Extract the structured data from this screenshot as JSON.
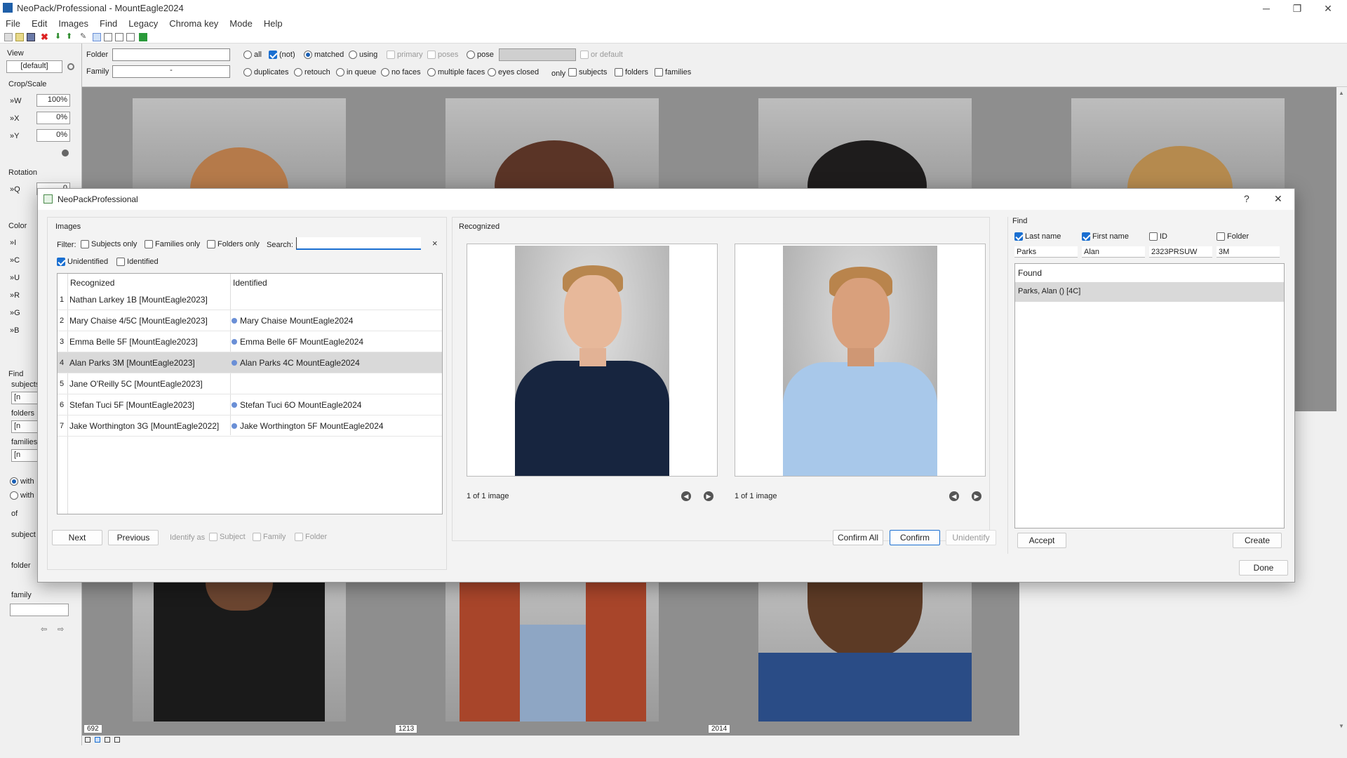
{
  "window": {
    "title": "NeoPack/Professional - MountEagle2024",
    "minimize": "─",
    "maximize": "❐",
    "close": "✕"
  },
  "menu": [
    "File",
    "Edit",
    "Images",
    "Find",
    "Legacy",
    "Chroma key",
    "Mode",
    "Help"
  ],
  "left": {
    "view_label": "View",
    "view_value": "[default]",
    "crop_label": "Crop/Scale",
    "w_label": "»W",
    "w_value": "100%",
    "x_label": "»X",
    "x_value": "0%",
    "y_label": "»Y",
    "y_value": "0%",
    "rotation_label": "Rotation",
    "q_label": "»Q",
    "q_value": "0",
    "color_label": "Color",
    "color_rows": [
      "»I",
      "»C",
      "»U",
      "»R",
      "»G",
      "»B"
    ],
    "find_label": "Find",
    "subjects_label": "subjects",
    "subjects_value": "[n",
    "folders_label": "folders",
    "folders_value": "[n",
    "families_label": "families",
    "families_value": "[n",
    "with1": "with",
    "with2": "with",
    "of_label": "of",
    "subject_label": "subject",
    "folder_label": "folder",
    "family_label": "family"
  },
  "filter": {
    "folder_label": "Folder",
    "folder_value": "",
    "family_label": "Family",
    "family_value": "-",
    "all": "all",
    "not": "(not)",
    "matched": "matched",
    "using": "using",
    "primary": "primary",
    "poses": "poses",
    "pose": "pose",
    "or_default": "or default",
    "duplicates": "duplicates",
    "retouch": "retouch",
    "in_queue": "in queue",
    "no_faces": "no faces",
    "multiple_faces": "multiple faces",
    "eyes_closed": "eyes closed",
    "only": "only",
    "subjects": "subjects",
    "folders": "folders",
    "families": "families"
  },
  "grid": {
    "cell_numbers": [
      "692",
      "1213",
      "2014"
    ]
  },
  "dialog": {
    "title": "NeoPackProfessional",
    "help": "?",
    "close": "✕",
    "images_label": "Images",
    "filter_label": "Filter:",
    "subjects_only": "Subjects only",
    "families_only": "Families only",
    "folders_only": "Folders only",
    "search_label": "Search:",
    "search_value": "",
    "clear_icon": "×",
    "unidentified": "Unidentified",
    "identified": "Identified",
    "col_recognized": "Recognized",
    "col_identified": "Identified",
    "rows": [
      {
        "num": "1",
        "recognized": "Nathan Larkey 1B [MountEagle2023]",
        "identified": ""
      },
      {
        "num": "2",
        "recognized": "Mary Chaise 4/5C [MountEagle2023]",
        "identified": "Mary Chaise  MountEagle2024"
      },
      {
        "num": "3",
        "recognized": "Emma Belle 5F [MountEagle2023]",
        "identified": "Emma Belle 6F MountEagle2024"
      },
      {
        "num": "4",
        "recognized": "Alan Parks 3M [MountEagle2023]",
        "identified": "Alan Parks 4C MountEagle2024"
      },
      {
        "num": "5",
        "recognized": "Jane O'Reilly 5C [MountEagle2023]",
        "identified": ""
      },
      {
        "num": "6",
        "recognized": "Stefan Tuci 5F [MountEagle2023]",
        "identified": "Stefan Tuci 6O MountEagle2024"
      },
      {
        "num": "7",
        "recognized": "Jake Worthington 3G [MountEagle2022]",
        "identified": "Jake Worthington 5F MountEagle2024"
      }
    ],
    "next": "Next",
    "previous": "Previous",
    "identify_as": "Identify as",
    "subject": "Subject",
    "family": "Family",
    "folder": "Folder",
    "recognized_label": "Recognized",
    "left_count": "1 of 1 image",
    "right_count": "1 of 1 image",
    "confirm_all": "Confirm All",
    "confirm": "Confirm",
    "unidentify": "Unidentify",
    "find_label": "Find",
    "last_name": "Last name",
    "first_name": "First name",
    "id": "ID",
    "folder_col": "Folder",
    "last_name_value": "Parks",
    "first_name_value": "Alan",
    "id_value": "2323PRSUW",
    "folder_value": "3M",
    "found_label": "Found",
    "found_item": "Parks, Alan () [4C]",
    "accept": "Accept",
    "create": "Create",
    "done": "Done"
  }
}
